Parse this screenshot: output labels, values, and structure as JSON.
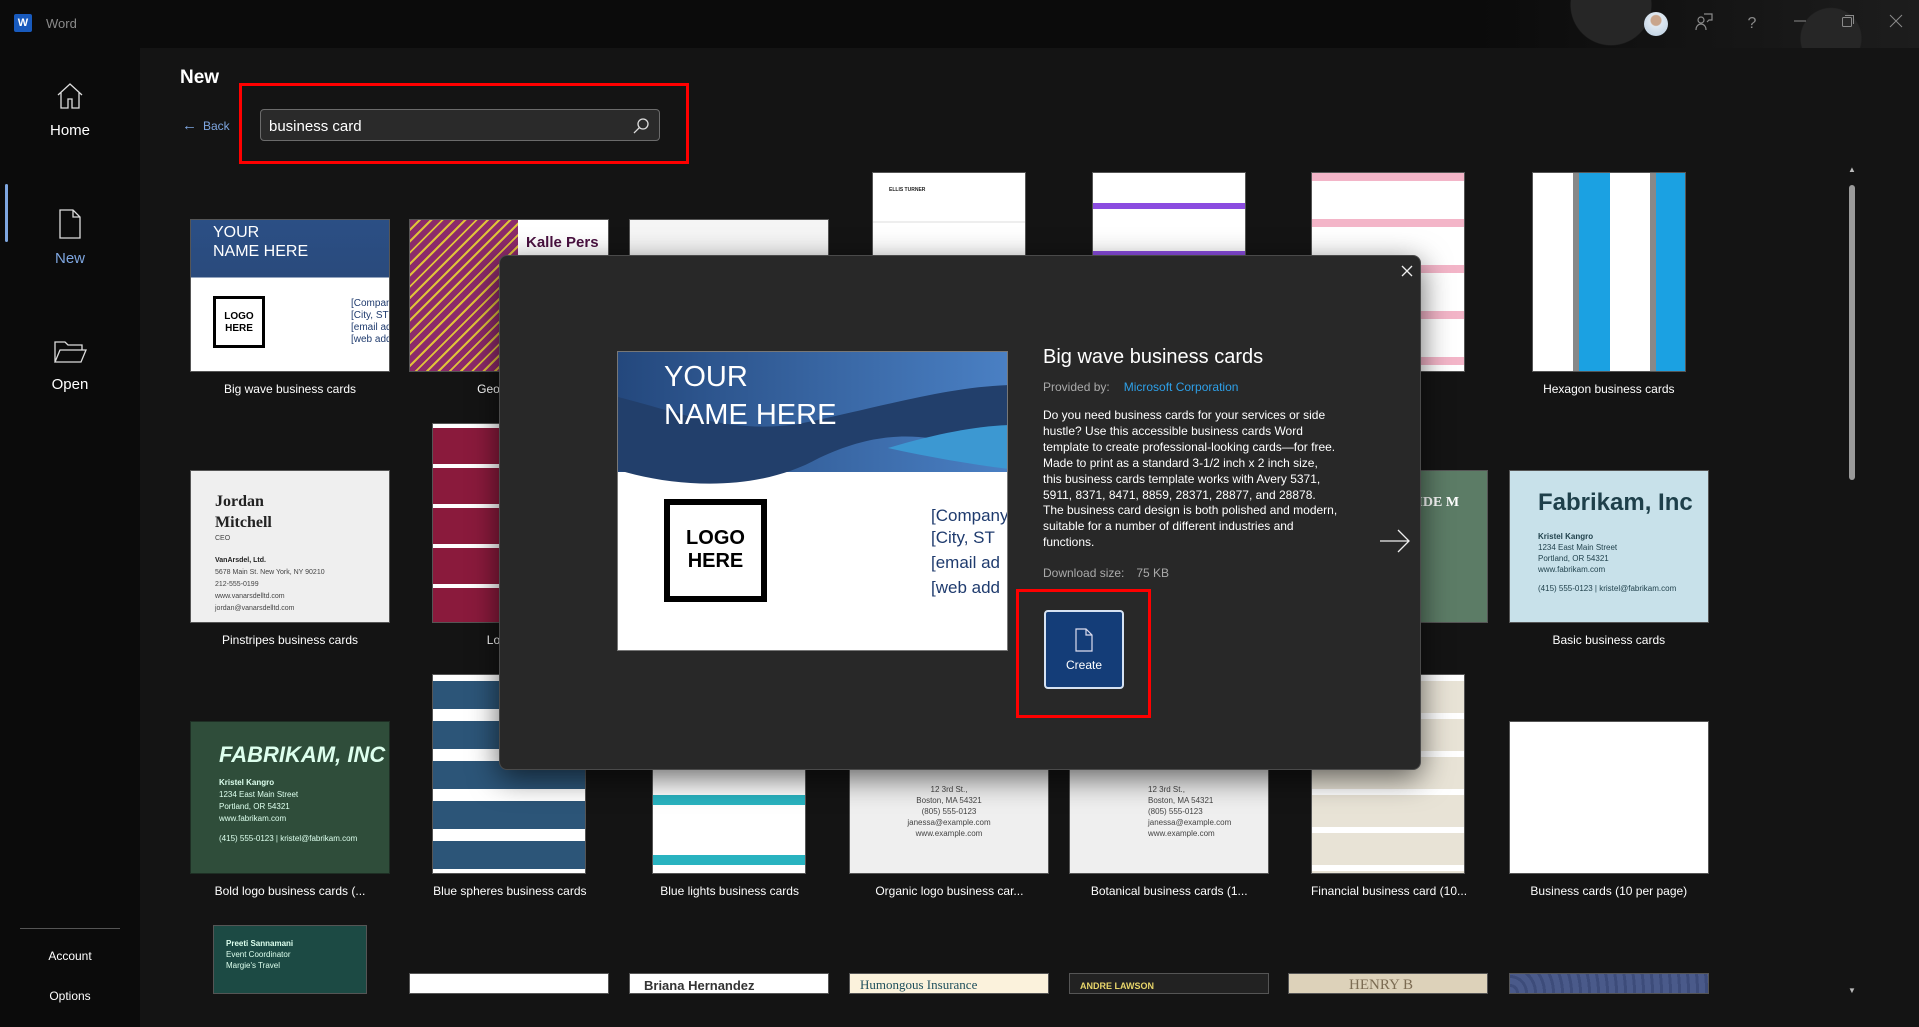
{
  "titlebar": {
    "app_name": "Word",
    "icons": [
      "avatar",
      "feedback-icon",
      "help-icon",
      "minimize-icon",
      "restore-icon",
      "close-icon"
    ],
    "help_glyph": "?"
  },
  "sidebar": {
    "items": [
      {
        "label": "Home",
        "icon": "home-icon"
      },
      {
        "label": "New",
        "icon": "new-document-icon",
        "selected": true
      },
      {
        "label": "Open",
        "icon": "folder-open-icon"
      }
    ],
    "bottom": [
      "Account",
      "Options"
    ]
  },
  "main": {
    "title": "New",
    "back_label": "Back",
    "search": {
      "value": "business card",
      "placeholder": ""
    }
  },
  "templates": [
    {
      "label": "Big wave business cards",
      "thumb": [
        "YOUR",
        "NAME HERE",
        "LOGO",
        "HERE",
        "[Company",
        "[City, ST",
        "[email ad",
        "[web add"
      ]
    },
    {
      "label": "Geometric b",
      "thumb": [
        "Kalle Pers"
      ]
    },
    {
      "label": "",
      "thumb": []
    },
    {
      "label": "",
      "thumb": [
        "ELLIS TURNER"
      ]
    },
    {
      "label": "",
      "thumb": []
    },
    {
      "label": "ards",
      "thumb": []
    },
    {
      "label": "Hexagon business cards",
      "thumb": []
    },
    {
      "label": "Pinstripes business cards",
      "thumb": [
        "Jordan",
        "Mitchell",
        "CEO",
        "VanArsdel, Ltd.",
        "5678 Main St. New York, NY 90210",
        "212-555-0199",
        "www.vanarsdelltd.com",
        "jordan@vanarsdelltd.com"
      ]
    },
    {
      "label": "Lotus bu",
      "thumb": []
    },
    {
      "label": "",
      "thumb": []
    },
    {
      "label": "",
      "thumb": []
    },
    {
      "label": "",
      "thumb": []
    },
    {
      "label": "cards",
      "thumb": [
        "AVIDE M"
      ]
    },
    {
      "label": "Basic business cards",
      "thumb": [
        "Fabrikam, Inc",
        "Kristel Kangro",
        "1234 East Main Street",
        "Portland, OR 54321",
        "www.fabrikam.com",
        "(415) 555-0123 | kristel@fabrikam.com"
      ]
    },
    {
      "label": "Bold logo business cards (...",
      "thumb": [
        "FABRIKAM, INC",
        "Kristel Kangro",
        "1234 East Main Street",
        "Portland, OR 54321",
        "www.fabrikam.com",
        "(415) 555-0123 | kristel@fabrikam.com"
      ]
    },
    {
      "label": "Blue spheres business cards",
      "thumb": []
    },
    {
      "label": "Blue lights business cards",
      "thumb": []
    },
    {
      "label": "Organic logo business car...",
      "thumb": [
        "12 3rd St.,",
        "Boston, MA 54321",
        "(805) 555-0123",
        "janessa@example.com",
        "www.example.com"
      ]
    },
    {
      "label": "Botanical business cards (1...",
      "thumb": [
        "12 3rd St.,",
        "Boston, MA 54321",
        "(805) 555-0123",
        "janessa@example.com",
        "www.example.com"
      ]
    },
    {
      "label": "Financial business card (10...",
      "thumb": []
    },
    {
      "label": "Business cards (10 per page)",
      "thumb": []
    },
    {
      "label": "",
      "thumb": [
        "Preeti Sannamani",
        "Event Coordinator",
        "Margie's Travel"
      ]
    },
    {
      "label": "",
      "thumb": []
    },
    {
      "label": "",
      "thumb": [
        "Briana Hernandez"
      ]
    },
    {
      "label": "",
      "thumb": [
        "Humongous Insurance"
      ]
    },
    {
      "label": "",
      "thumb": [
        "ANDRE LAWSON"
      ]
    },
    {
      "label": "",
      "thumb": [
        "HENRY B"
      ]
    },
    {
      "label": "",
      "thumb": []
    }
  ],
  "dialog": {
    "title": "Big wave business cards",
    "provided_by_label": "Provided by:",
    "provider": "Microsoft Corporation",
    "description": "Do you need business cards for your services or side hustle? Use this accessible business cards Word template to create professional-looking cards—for free. Made to print as a standard 3-1/2 inch x 2 inch size, this business cards template works with Avery 5371, 5911, 8371, 8471, 8859, 28371, 28877, and 28878. The business card design is both polished and modern, suitable for a number of different industries and functions.",
    "download_size_label": "Download size:",
    "download_size": "75 KB",
    "create_label": "Create",
    "preview": {
      "name_line1": "YOUR",
      "name_line2": "NAME HERE",
      "logo_line1": "LOGO",
      "logo_line2": "HERE",
      "company": "[Company",
      "city": "[City, ST",
      "email": "[email ad",
      "web": "[web add"
    }
  },
  "colors": {
    "accent": "#7ea6e0",
    "highlight": "#ff0000",
    "create_button": "#143d78",
    "link": "#2ea0e8"
  }
}
